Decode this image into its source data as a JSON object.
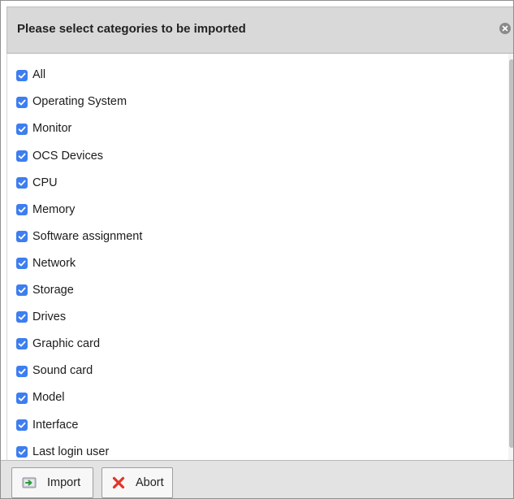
{
  "dialog": {
    "title": "Please select categories to be imported",
    "close_icon": "close-icon"
  },
  "categories": [
    {
      "label": "All",
      "checked": true
    },
    {
      "label": "Operating System",
      "checked": true
    },
    {
      "label": "Monitor",
      "checked": true
    },
    {
      "label": "OCS Devices",
      "checked": true
    },
    {
      "label": "CPU",
      "checked": true
    },
    {
      "label": "Memory",
      "checked": true
    },
    {
      "label": "Software assignment",
      "checked": true
    },
    {
      "label": "Network",
      "checked": true
    },
    {
      "label": "Storage",
      "checked": true
    },
    {
      "label": "Drives",
      "checked": true
    },
    {
      "label": "Graphic card",
      "checked": true
    },
    {
      "label": "Sound card",
      "checked": true
    },
    {
      "label": "Model",
      "checked": true
    },
    {
      "label": "Interface",
      "checked": true
    },
    {
      "label": "Last login user",
      "checked": true
    }
  ],
  "footer": {
    "import_label": "Import",
    "import_icon": "import-icon",
    "abort_label": "Abort",
    "abort_icon": "abort-icon"
  },
  "colors": {
    "checkbox_checked": "#3d7ef0",
    "titlebar": "#d9d9d9",
    "footer": "#e3e3e3",
    "abort_x": "#e2342a"
  }
}
